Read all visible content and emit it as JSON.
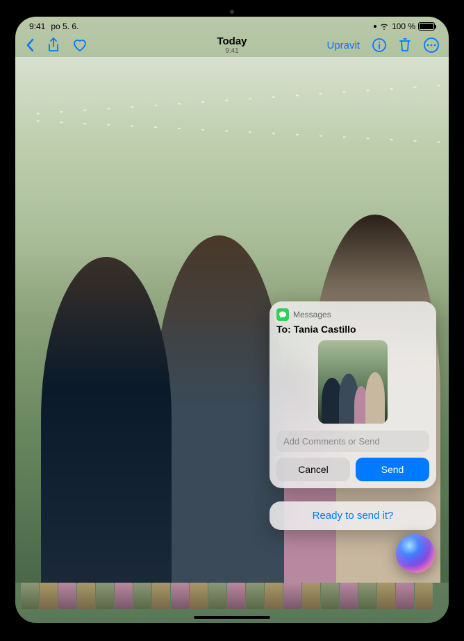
{
  "status": {
    "time": "9:41",
    "date": "po 5. 6.",
    "battery_pct": "100 %"
  },
  "nav": {
    "title": "Today",
    "subtitle": "9:41",
    "edit_label": "Upravit"
  },
  "siri_card": {
    "app_name": "Messages",
    "to_prefix": "To:",
    "to_name": "Tania Castillo",
    "input_placeholder": "Add Comments or Send",
    "cancel_label": "Cancel",
    "send_label": "Send"
  },
  "siri_prompt": "Ready to send it?"
}
